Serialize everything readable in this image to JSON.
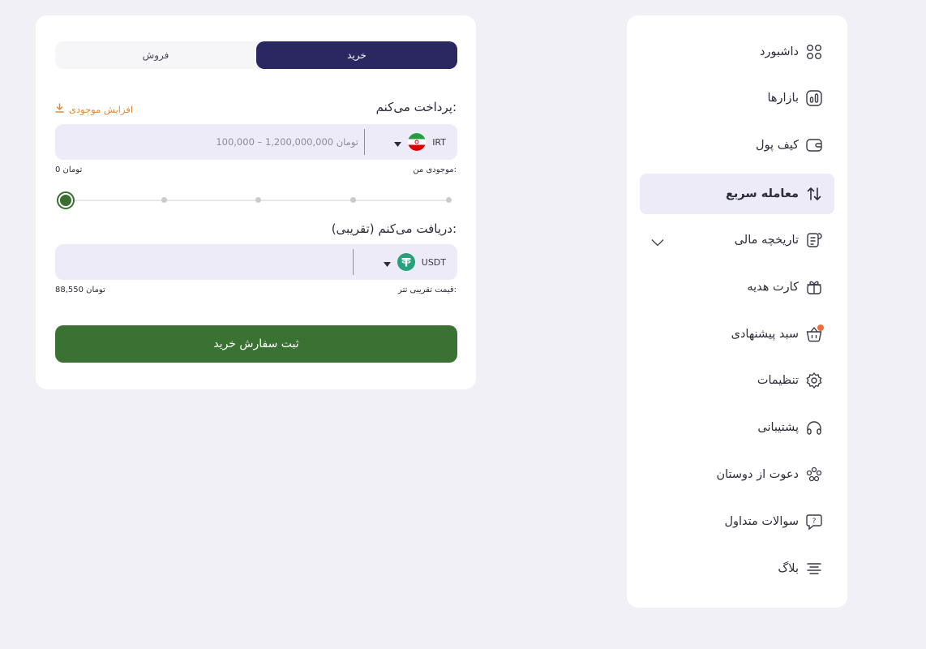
{
  "sidebar": {
    "items": [
      {
        "label": "داشبورد",
        "icon": "dashboard-icon"
      },
      {
        "label": "بازارها",
        "icon": "markets-icon"
      },
      {
        "label": "کیف پول",
        "icon": "wallet-icon"
      },
      {
        "label": "معامله سریع",
        "icon": "swap-arrows-icon",
        "active": true
      },
      {
        "label": "تاریخچه مالی",
        "icon": "receipt-icon",
        "has_submenu": true
      },
      {
        "label": "کارت هدیه",
        "icon": "gift-icon"
      },
      {
        "label": "سبد پیشنهادی",
        "icon": "basket-icon",
        "has_notification": true
      },
      {
        "label": "تنظیمات",
        "icon": "gear-icon"
      },
      {
        "label": "پشتیبانی",
        "icon": "headset-icon"
      },
      {
        "label": "دعوت از دوستان",
        "icon": "people-icon"
      },
      {
        "label": "سوالات متداول",
        "icon": "question-bubble-icon"
      },
      {
        "label": "بلاگ",
        "icon": "list-lines-icon"
      }
    ]
  },
  "trade": {
    "tabs": {
      "buy": "خرید",
      "sell": "فروش",
      "active": "buy"
    },
    "pay": {
      "title": "پرداخت می‌کنم:",
      "increase_balance": "افزایش موجودی",
      "currency_code": "IRT",
      "placeholder": "100,000 – 1,200,000,000 تومان",
      "balance_label": "موجودی من:",
      "balance_value": "0 تومان"
    },
    "slider": {
      "percent": 0
    },
    "receive": {
      "title": "دریافت می‌کنم (تقریبی):",
      "currency_code": "USDT",
      "price_label": "قیمت تقریبی تتر:",
      "price_value": "88,550 تومان"
    },
    "submit_label": "ثبت سفارش خرید"
  },
  "colors": {
    "primary": "#2b2861",
    "success": "#3a7233",
    "accent": "#f26b3a",
    "tether": "#26a17b"
  }
}
